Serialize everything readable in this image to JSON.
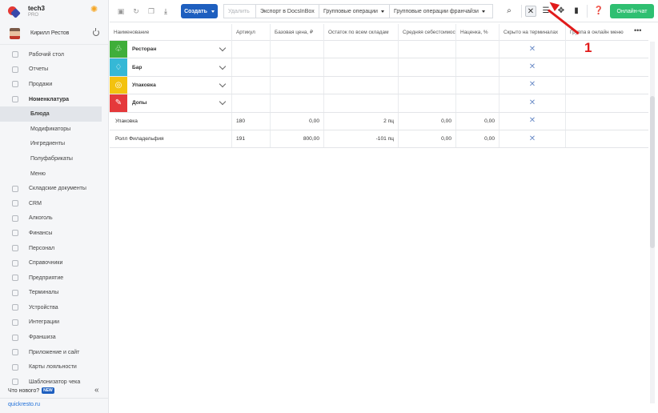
{
  "brand": {
    "name": "tech3",
    "plan": "PRO"
  },
  "user": {
    "name": "Кирилл Рестов"
  },
  "sidebar": {
    "items": [
      {
        "label": "Рабочий стол",
        "icon": "dashboard-icon"
      },
      {
        "label": "Отчеты",
        "icon": "reports-icon"
      },
      {
        "label": "Продажи",
        "icon": "cart-icon"
      },
      {
        "label": "Номенклатура",
        "icon": "tag-icon",
        "expanded": true
      }
    ],
    "sub_items": [
      {
        "label": "Блюда",
        "active": true
      },
      {
        "label": "Модификаторы"
      },
      {
        "label": "Ингредиенты"
      },
      {
        "label": "Полуфабрикаты"
      },
      {
        "label": "Меню"
      }
    ],
    "items_after": [
      {
        "label": "Складские документы",
        "icon": "warehouse-icon"
      },
      {
        "label": "CRM",
        "icon": "crm-icon"
      },
      {
        "label": "Алкоголь",
        "icon": "glass-icon"
      },
      {
        "label": "Финансы",
        "icon": "finance-icon"
      },
      {
        "label": "Персонал",
        "icon": "staff-icon"
      },
      {
        "label": "Справочники",
        "icon": "book-icon"
      },
      {
        "label": "Предприятие",
        "icon": "building-icon"
      },
      {
        "label": "Терминалы",
        "icon": "terminal-icon"
      },
      {
        "label": "Устройства",
        "icon": "device-icon"
      },
      {
        "label": "Интеграции",
        "icon": "link-icon"
      },
      {
        "label": "Франшиза",
        "icon": "franchise-icon"
      },
      {
        "label": "Приложение и сайт",
        "icon": "app-icon"
      },
      {
        "label": "Карты лояльности",
        "icon": "card-icon"
      },
      {
        "label": "Шаблонизатор чека",
        "icon": "receipt-icon"
      }
    ],
    "whats_new": "Что нового?",
    "new_badge": "NEW",
    "footer_link": "quickresto.ru"
  },
  "toolbar": {
    "create_label": "Создать",
    "delete_label": "Удалить",
    "export_label": "Экспорт в DocsInBox",
    "group_ops_label": "Групповые операции",
    "franchise_ops_label": "Групповые операции франчайзи",
    "chat_label": "Онлайн-чат"
  },
  "table": {
    "columns": [
      "Наименование",
      "Артикул",
      "Базовая цена, ₽",
      "Остаток по всем складам",
      "Средняя себестоимость",
      "Наценка, %",
      "Скрыто на терминалах",
      "Группа в онлайн меню"
    ],
    "groups": [
      {
        "name": "Ресторан",
        "color": "#3fae3a",
        "icon": "cherries-icon",
        "glyph": "♧"
      },
      {
        "name": "Бар",
        "color": "#35b8d6",
        "icon": "cocktail-icon",
        "glyph": "♢"
      },
      {
        "name": "Упаковка",
        "color": "#f3c20f",
        "icon": "lemon-icon",
        "glyph": "◎"
      },
      {
        "name": "Допы",
        "color": "#e5393b",
        "icon": "pepper-icon",
        "glyph": "✎"
      }
    ],
    "rows": [
      {
        "name": "Упаковка",
        "sku": "180",
        "price": "0,00",
        "stock": "2 пц",
        "cost": "0,00",
        "markup": "0,00"
      },
      {
        "name": "Ролл Филадельфия",
        "sku": "191",
        "price": "800,00",
        "stock": "-101 пц",
        "cost": "0,00",
        "markup": "0,00"
      }
    ]
  },
  "annotation": {
    "number": "1"
  }
}
